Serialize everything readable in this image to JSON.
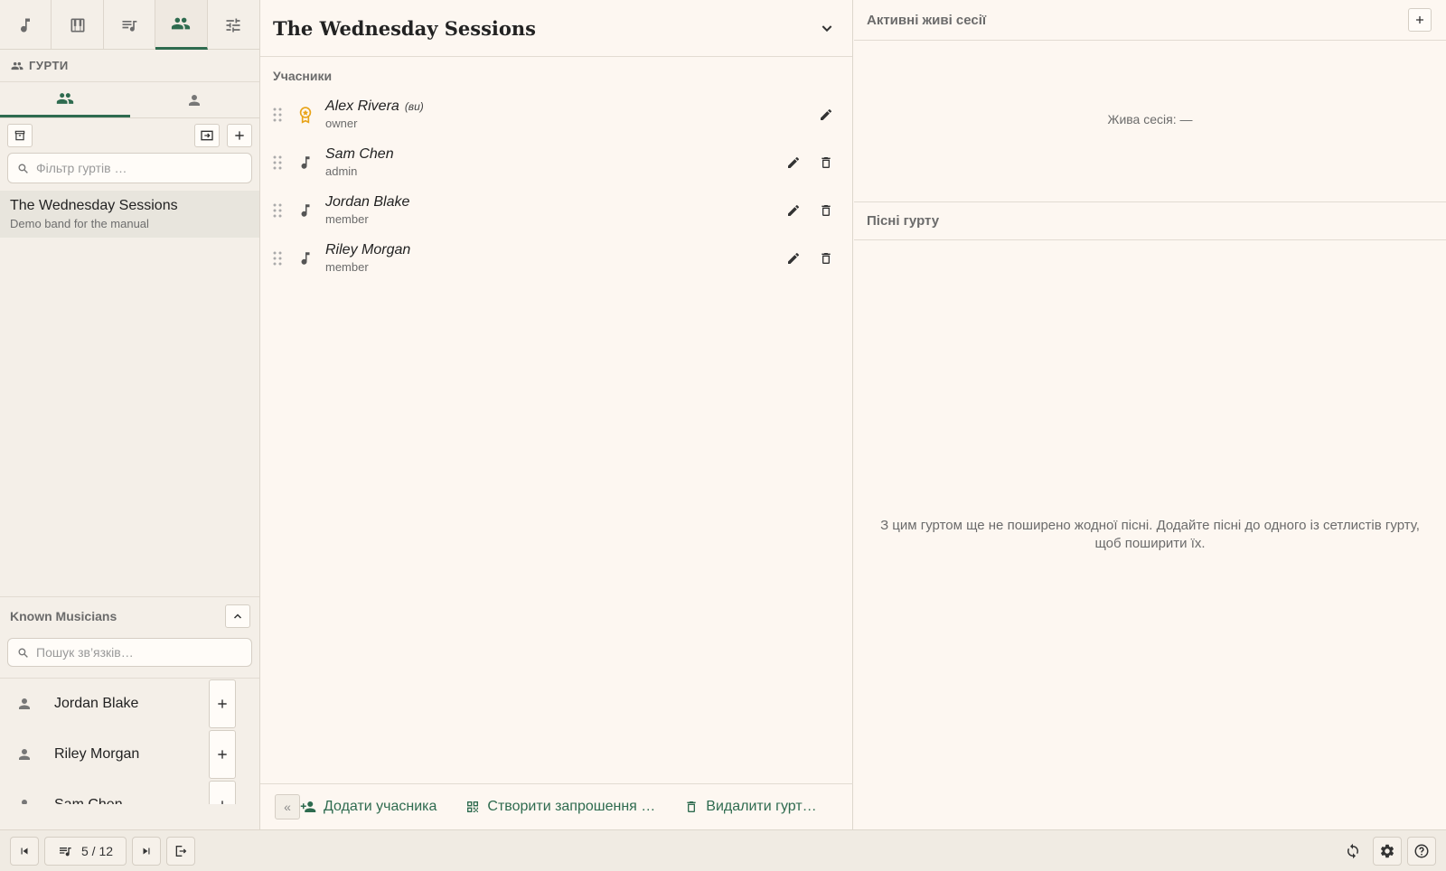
{
  "nav": {
    "tabs": [
      {
        "icon": "music-note-icon"
      },
      {
        "icon": "piano-icon"
      },
      {
        "icon": "playlist-icon"
      },
      {
        "icon": "group-icon",
        "active": true
      },
      {
        "icon": "sliders-icon"
      }
    ]
  },
  "sidebar": {
    "section_title": "ГУРТИ",
    "filter_placeholder": "Фільтр гуртів …",
    "bands": [
      {
        "name": "The Wednesday Sessions",
        "description": "Demo band for the manual"
      }
    ],
    "known": {
      "title": "Known Musicians",
      "search_placeholder": "Пошук зв’язків…",
      "contacts": [
        {
          "name": "Jordan Blake"
        },
        {
          "name": "Riley Morgan"
        },
        {
          "name": "Sam Chen"
        }
      ]
    }
  },
  "band": {
    "title": "The Wednesday Sessions",
    "members_label": "Учасники",
    "members": [
      {
        "name": "Alex Rivera",
        "you": "(ви)",
        "role": "owner"
      },
      {
        "name": "Sam Chen",
        "role": "admin"
      },
      {
        "name": "Jordan Blake",
        "role": "member"
      },
      {
        "name": "Riley Morgan",
        "role": "member"
      }
    ],
    "footer": {
      "collapse": "«",
      "add_member": "Додати учасника",
      "create_invite": "Створити запрошення …",
      "delete_band": "Видалити гурт…"
    }
  },
  "right": {
    "live_title": "Активні живі сесії",
    "live_empty": "Жива сесія: —",
    "songs_title": "Пісні гурту",
    "songs_empty": "З цим гуртом ще не поширено жодної пісні. Додайте пісні до одного із сетлистів гурту, щоб поширити їх."
  },
  "bottom": {
    "position": "5 / 12"
  },
  "colors": {
    "accent": "#2e6b4f",
    "owner": "#e8a317"
  }
}
